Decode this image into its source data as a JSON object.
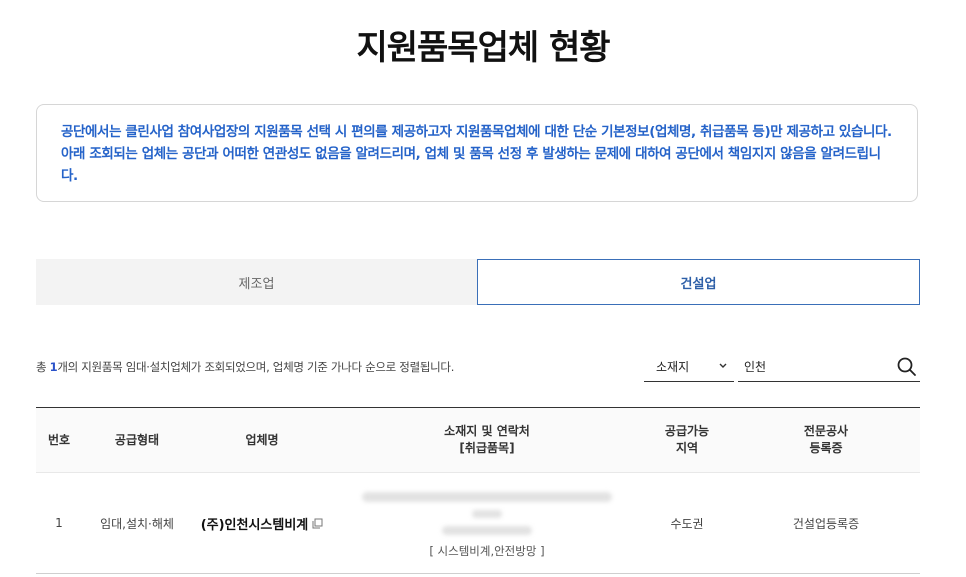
{
  "page": {
    "title": "지원품목업체 현황"
  },
  "notice": {
    "text": "공단에서는 클린사업 참여사업장의 지원품목 선택 시 편의를 제공하고자 지원품목업체에 대한 단순 기본정보(업체명, 취급품목 등)만 제공하고 있습니다. 아래 조회되는 업체는 공단과 어떠한 연관성도 없음을 알려드리며, 업체 및 품목 선정 후 발생하는 문제에 대하여 공단에서 책임지지 않음을 알려드립니다."
  },
  "tabs": [
    {
      "label": "제조업",
      "active": false
    },
    {
      "label": "건설업",
      "active": true
    }
  ],
  "summary": {
    "prefix": "총 ",
    "count": "1",
    "suffix": "개의 지원품목 임대·설치업체가 조회되었으며, 업체명 기준 가나다 순으로 정렬됩니다."
  },
  "search": {
    "select_value": "소재지",
    "query": "인천",
    "search_icon": "search-icon",
    "dropdown_icon": "chevron-down-icon"
  },
  "table": {
    "headers": {
      "no": "번호",
      "type": "공급형태",
      "name": "업체명",
      "location_line1": "소재지 및 연락처",
      "location_line2": "[취급품목]",
      "area_line1": "공급가능",
      "area_line2": "지역",
      "license_line1": "전문공사",
      "license_line2": "등록증"
    },
    "rows": [
      {
        "no": "1",
        "type": "임대,설치·해체",
        "name": "(주)인천시스템비계",
        "items": "[ 시스템비계,안전방망 ]",
        "area": "수도권",
        "license": "건설업등록증"
      }
    ]
  },
  "colors": {
    "notice_text": "#2563c9",
    "active_tab_border": "#3a6fb8",
    "count_highlight": "#2a52c9"
  }
}
